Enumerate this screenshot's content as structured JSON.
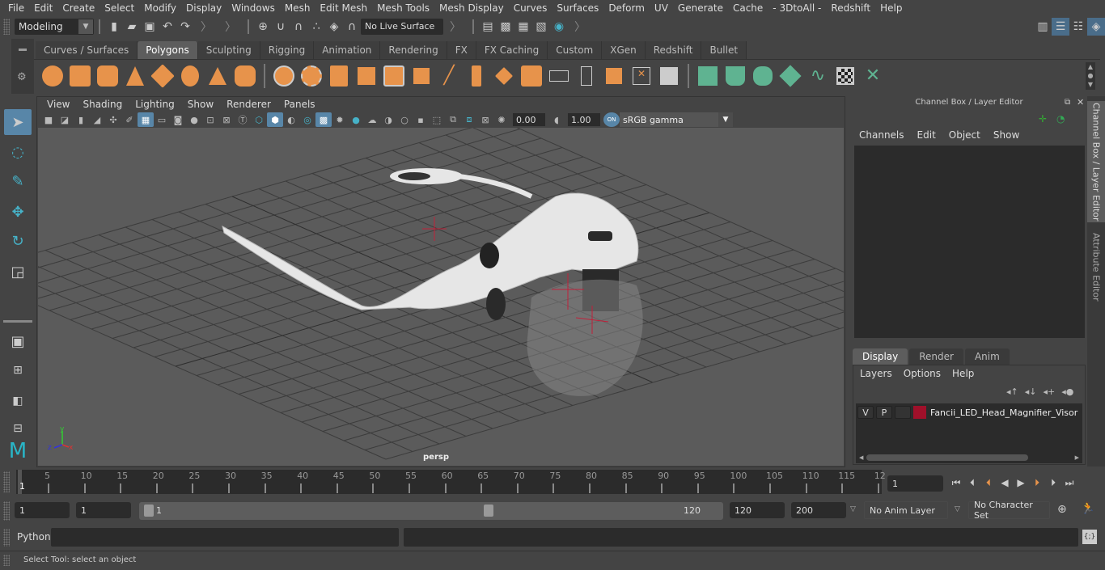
{
  "menubar": [
    "File",
    "Edit",
    "Create",
    "Select",
    "Modify",
    "Display",
    "Windows",
    "Mesh",
    "Edit Mesh",
    "Mesh Tools",
    "Mesh Display",
    "Curves",
    "Surfaces",
    "Deform",
    "UV",
    "Generate",
    "Cache",
    "- 3DtoAll -",
    "Redshift",
    "Help"
  ],
  "statusline": {
    "mode": "Modeling",
    "live_surface": "No Live Surface"
  },
  "shelf": {
    "tabs": [
      "Curves / Surfaces",
      "Polygons",
      "Sculpting",
      "Rigging",
      "Animation",
      "Rendering",
      "FX",
      "FX Caching",
      "Custom",
      "XGen",
      "Redshift",
      "Bullet"
    ],
    "active_tab": "Polygons"
  },
  "viewport": {
    "menu": [
      "View",
      "Shading",
      "Lighting",
      "Show",
      "Renderer",
      "Panels"
    ],
    "exposure": "0.00",
    "gamma": "1.00",
    "color_management": "ON",
    "color_space": "sRGB gamma",
    "camera_label": "persp",
    "axis": {
      "x": "x",
      "y": "y",
      "z": "z"
    }
  },
  "channel_box": {
    "title": "Channel Box / Layer Editor",
    "menu": [
      "Channels",
      "Edit",
      "Object",
      "Show"
    ]
  },
  "layer_editor": {
    "tabs": [
      "Display",
      "Render",
      "Anim"
    ],
    "active_tab": "Display",
    "menu": [
      "Layers",
      "Options",
      "Help"
    ],
    "layers": [
      {
        "visible": "V",
        "playback": "P",
        "name": "Fancii_LED_Head_Magnifier_Visor",
        "color": "#a0102a"
      }
    ]
  },
  "side_tabs": [
    "Channel Box / Layer Editor",
    "Attribute Editor"
  ],
  "timeline": {
    "ticks": [
      "5",
      "10",
      "15",
      "20",
      "25",
      "30",
      "35",
      "40",
      "45",
      "50",
      "55",
      "60",
      "65",
      "70",
      "75",
      "80",
      "85",
      "90",
      "95",
      "100",
      "105",
      "110",
      "115",
      "12"
    ],
    "current_frame_marker": "1",
    "current_frame": "1"
  },
  "range": {
    "start": "1",
    "playback_start": "1",
    "slider_start": "1",
    "slider_end": "120",
    "playback_end": "120",
    "end": "200",
    "anim_layer": "No Anim Layer",
    "character_set": "No Character Set"
  },
  "command": {
    "label": "Python"
  },
  "status_message": "Select Tool: select an object"
}
